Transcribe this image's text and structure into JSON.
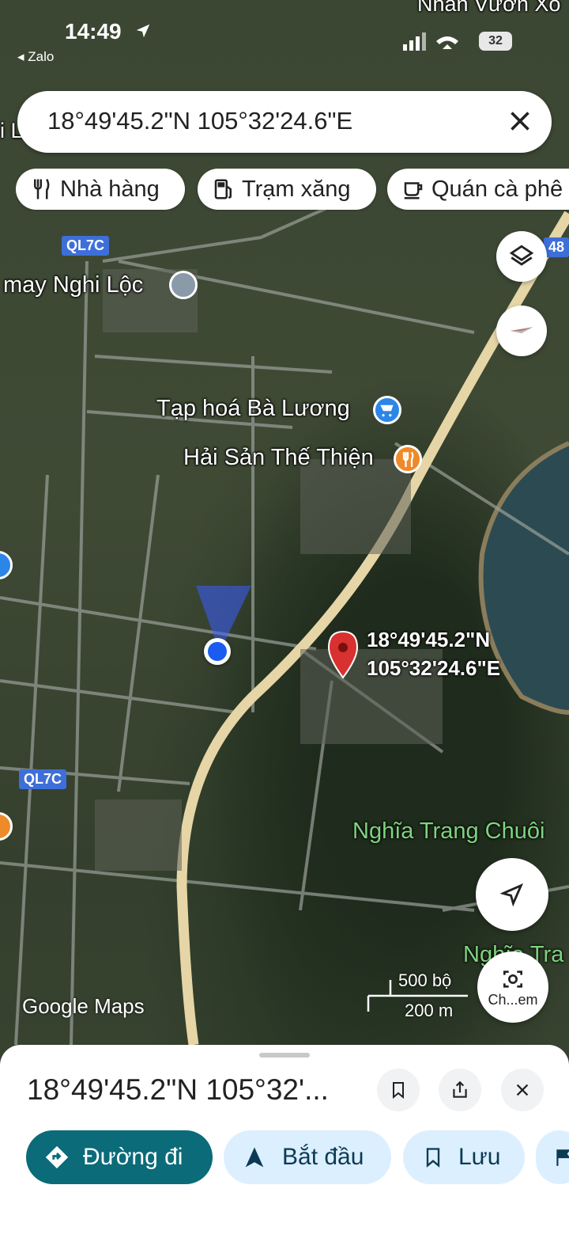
{
  "status_bar": {
    "time": "14:49",
    "back_app": "◂ Zalo",
    "battery": "32"
  },
  "search": {
    "query": "18°49'45.2\"N 105°32'24.6\"E"
  },
  "chips": [
    {
      "label": "Nhà hàng",
      "icon": "fork-knife-icon"
    },
    {
      "label": "Trạm xăng",
      "icon": "gas-station-icon"
    },
    {
      "label": "Quán cà phê",
      "icon": "coffee-cup-icon"
    }
  ],
  "map": {
    "top_partial_label": "Nhãn Vườn Xo",
    "left_partial_label": "i L",
    "road_labels": [
      "QL7C",
      "QL7C",
      "48"
    ],
    "pois": [
      {
        "label": "may Nghi Lộc",
        "icon": "location-pin-icon"
      },
      {
        "label": "Tạp hoá Bà Lương",
        "icon": "shopping-cart-icon"
      },
      {
        "label": "Hải Sản Thế Thiện",
        "icon": "restaurant-icon"
      }
    ],
    "dropped_pin": {
      "lat": "18°49'45.2\"N",
      "lng": "105°32'24.6\"E"
    },
    "area_label": "Nghĩa Trang Chuôi",
    "area_label_2": "Nghĩa Tra",
    "google_logo": "Google Maps",
    "scale": {
      "imperial": "500 bộ",
      "metric": "200 m"
    },
    "lens_label": "Ch...em"
  },
  "sheet": {
    "title": "18°49'45.2\"N 105°32'...",
    "actions": [
      {
        "label": "Đường đi",
        "icon": "directions-icon",
        "style": "primary"
      },
      {
        "label": "Bắt đầu",
        "icon": "navigation-arrow-icon",
        "style": "secondary"
      },
      {
        "label": "Lưu",
        "icon": "bookmark-icon",
        "style": "secondary"
      }
    ]
  },
  "colors": {
    "primary_teal": "#0b6b78",
    "secondary_bg": "#dcefff",
    "pin_red": "#d93030",
    "road_label_blue": "#3e6fd8",
    "area_label_green": "#7fd37f"
  }
}
